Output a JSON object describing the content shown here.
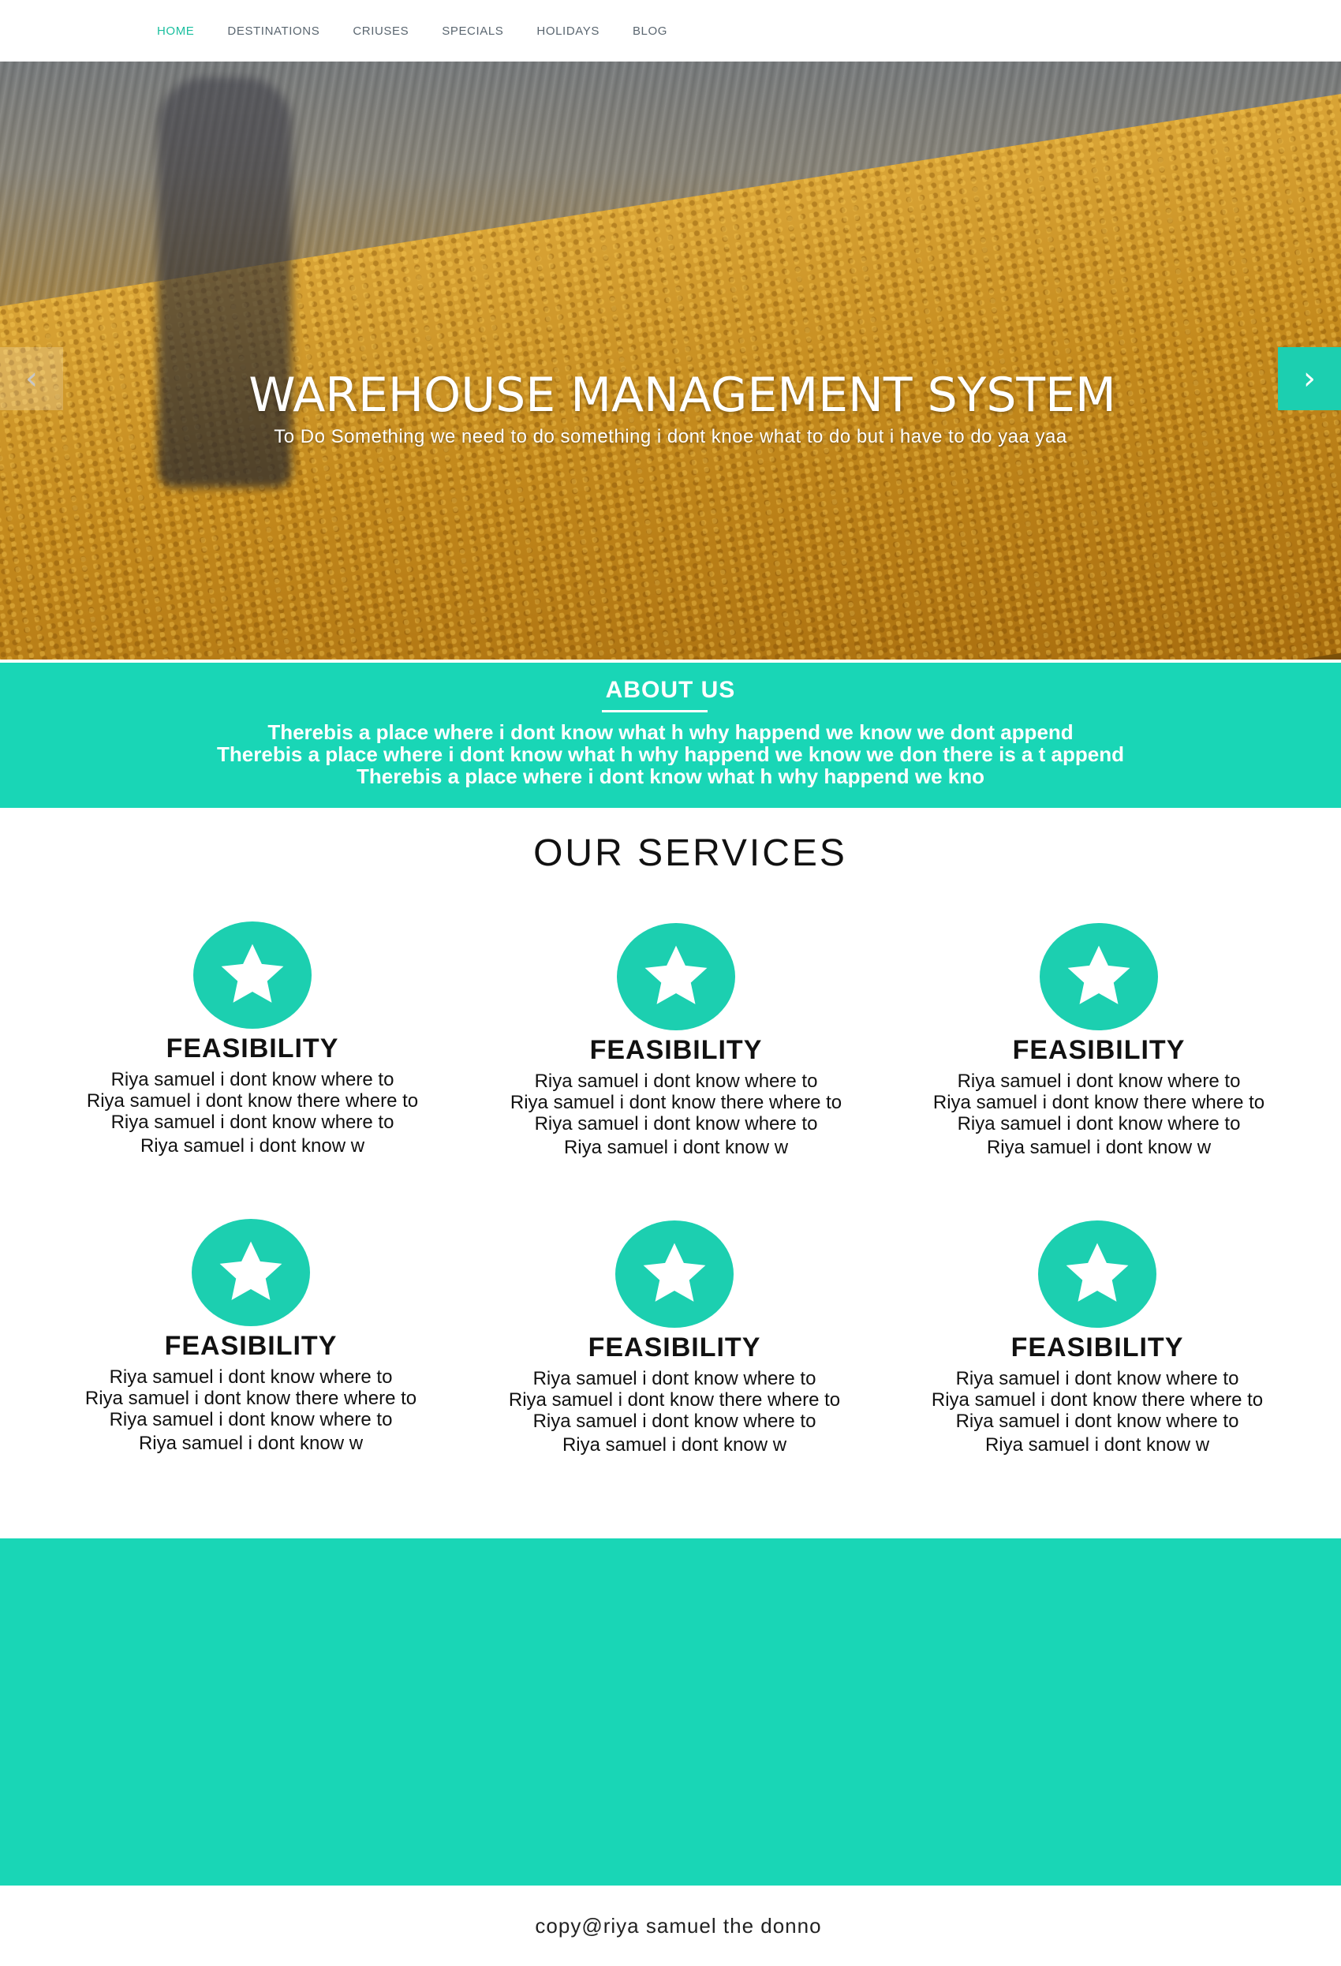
{
  "nav": {
    "items": [
      {
        "label": "HOME",
        "active": true
      },
      {
        "label": "DESTINATIONS",
        "active": false
      },
      {
        "label": "CRIUSES",
        "active": false
      },
      {
        "label": "SPECIALS",
        "active": false
      },
      {
        "label": "HOLIDAYS",
        "active": false
      },
      {
        "label": "BLOG",
        "active": false
      }
    ]
  },
  "hero": {
    "title": "WAREHOUSE MANAGEMENT SYSTEM",
    "subtitle": "To Do Something we need to do something i dont knoe what to do but i have to do yaa yaa",
    "prev_icon": "chevron-left-icon",
    "next_icon": "chevron-right-icon"
  },
  "about": {
    "title": "ABOUT US",
    "lines": [
      "Therebis a place where i dont know what h why happend  we know we dont append",
      "Therebis a place where i dont know what h why happend  we know we don there is a t append",
      "Therebis a place where i dont know what h why happend  we kno"
    ]
  },
  "services": {
    "title": "OUR SERVICES",
    "icon": "star-icon",
    "items": [
      {
        "heading": "FEASIBILITY",
        "lines": [
          "Riya samuel i dont know where to",
          "Riya samuel i dont know there where to",
          "Riya samuel i dont know where to",
          "Riya samuel i dont know w"
        ]
      },
      {
        "heading": "FEASIBILITY",
        "lines": [
          "Riya samuel i dont know where to",
          "Riya samuel i dont know there where to",
          "Riya samuel i dont know where to",
          "Riya samuel i dont know w"
        ]
      },
      {
        "heading": "FEASIBILITY",
        "lines": [
          "Riya samuel i dont know where to",
          "Riya samuel i dont know there where to",
          "Riya samuel i dont know where to",
          "Riya samuel i dont know w"
        ]
      },
      {
        "heading": "FEASIBILITY",
        "lines": [
          "Riya samuel i dont know where to",
          "Riya samuel i dont know there where to",
          "Riya samuel i dont know where to",
          "Riya samuel i dont know w"
        ]
      },
      {
        "heading": "FEASIBILITY",
        "lines": [
          "Riya samuel i dont know where to",
          "Riya samuel i dont know there where to",
          "Riya samuel i dont know where to",
          "Riya samuel i dont know w"
        ]
      },
      {
        "heading": "FEASIBILITY",
        "lines": [
          "Riya samuel i dont know where to",
          "Riya samuel i dont know there where to",
          "Riya samuel i dont know where to",
          "Riya samuel i dont know w"
        ]
      }
    ]
  },
  "footer": {
    "copyright": "copy@riya samuel the donno"
  },
  "colors": {
    "accent": "#19d6b6",
    "nav_active": "#1bbf9f",
    "nav_text": "#5a6670"
  }
}
